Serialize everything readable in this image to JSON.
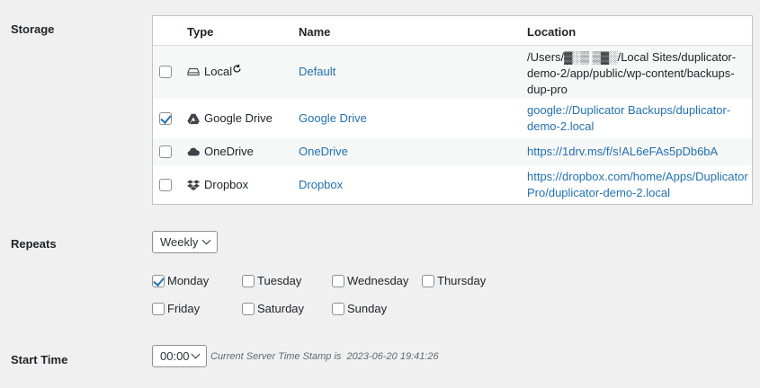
{
  "labels": {
    "storage": "Storage",
    "repeats": "Repeats",
    "start_time": "Start Time"
  },
  "storage_table": {
    "headers": {
      "type": "Type",
      "name": "Name",
      "location": "Location"
    },
    "rows": [
      {
        "checked": false,
        "type": "Local",
        "type_icon": "hard-drive-icon",
        "type_suffix_icon": "refresh-icon",
        "name": "Default",
        "location_lines": [
          "/Users/▓░▒ ▒▓░/Local Sites/duplicator-",
          "demo-2/app/public/wp-content/backups-",
          "dup-pro"
        ],
        "location_is_link": false
      },
      {
        "checked": true,
        "type": "Google Drive",
        "type_icon": "google-drive-icon",
        "name": "Google Drive",
        "location_lines": [
          "google://Duplicator Backups/duplicator-",
          "demo-2.local"
        ],
        "location_is_link": true
      },
      {
        "checked": false,
        "type": "OneDrive",
        "type_icon": "cloud-icon",
        "name": "OneDrive",
        "location_lines": [
          "https://1drv.ms/f/s!AL6eFAs5pDb6bA"
        ],
        "location_is_link": true
      },
      {
        "checked": false,
        "type": "Dropbox",
        "type_icon": "dropbox-icon",
        "name": "Dropbox",
        "location_lines": [
          "https://dropbox.com/home/Apps/Duplicator",
          "Pro/duplicator-demo-2.local"
        ],
        "location_is_link": true
      }
    ]
  },
  "repeats": {
    "selected": "Weekly",
    "days": [
      {
        "label": "Monday",
        "checked": true
      },
      {
        "label": "Tuesday",
        "checked": false
      },
      {
        "label": "Wednesday",
        "checked": false
      },
      {
        "label": "Thursday",
        "checked": false
      },
      {
        "label": "Friday",
        "checked": false
      },
      {
        "label": "Saturday",
        "checked": false
      },
      {
        "label": "Sunday",
        "checked": false
      }
    ]
  },
  "start_time": {
    "selected": "00:00",
    "hint_prefix": "Current Server Time Stamp is",
    "hint_value": "2023-06-20 19:41:26"
  },
  "colors": {
    "link": "#2271b1",
    "background": "#f0f0f1",
    "table_alt_row": "#f6f7f7"
  }
}
